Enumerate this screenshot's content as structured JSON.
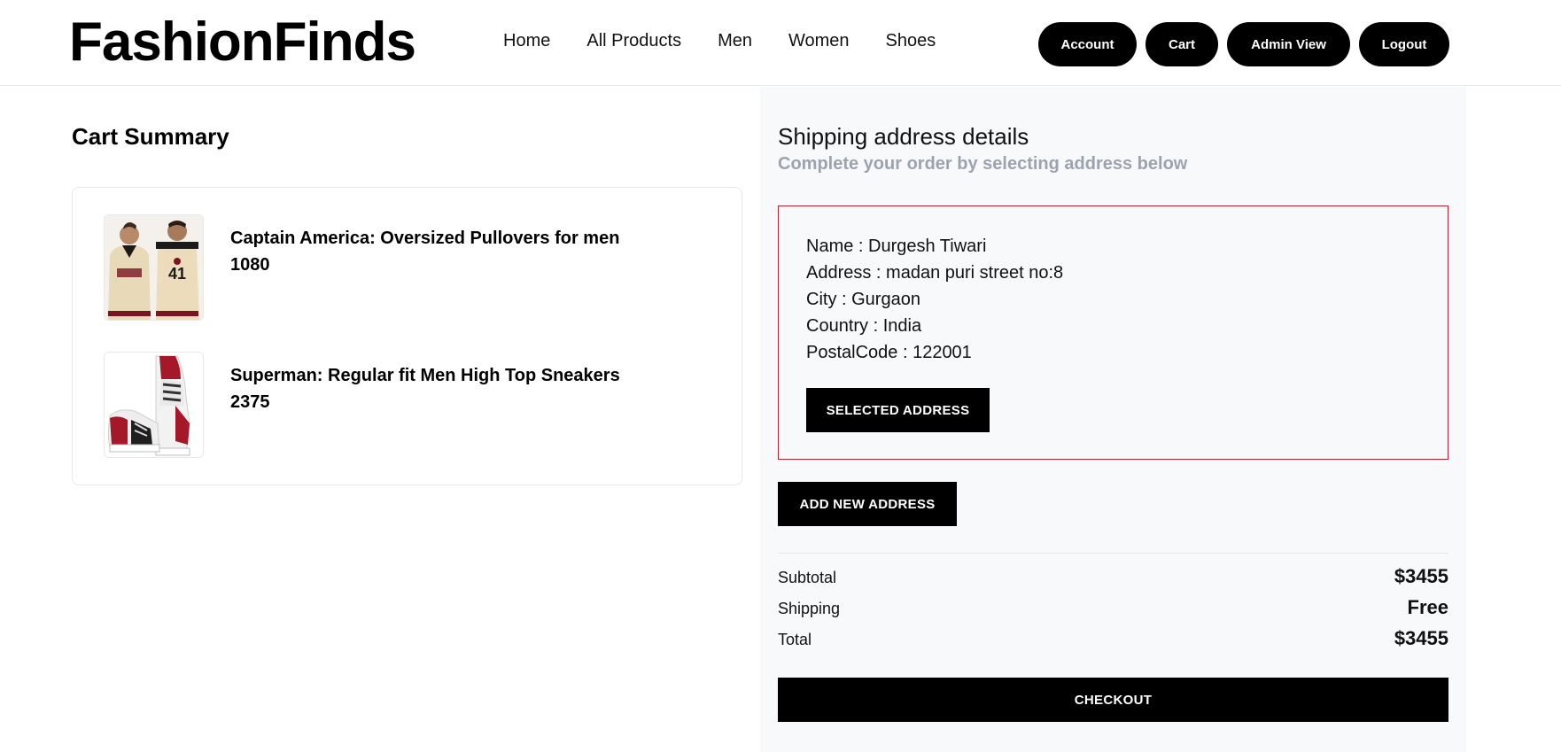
{
  "header": {
    "logo": "FashionFinds",
    "nav": [
      "Home",
      "All Products",
      "Men",
      "Women",
      "Shoes"
    ],
    "actions": [
      "Account",
      "Cart",
      "Admin View",
      "Logout"
    ]
  },
  "cart": {
    "title": "Cart Summary",
    "items": [
      {
        "name": "Captain America: Oversized Pullovers for men",
        "price": "1080",
        "image": "pullover-photo"
      },
      {
        "name": "Superman: Regular fit Men High Top Sneakers",
        "price": "2375",
        "image": "sneaker-photo"
      }
    ]
  },
  "shipping": {
    "title": "Shipping address details",
    "subtitle": "Complete your order by selecting address below",
    "address": {
      "name": "Name : Durgesh Tiwari",
      "street": "Address : madan puri street no:8",
      "city": "City : Gurgaon",
      "country": "Country : India",
      "postal": "PostalCode : 122001"
    },
    "selected_button": "SELECTED ADDRESS",
    "add_button": "ADD NEW ADDRESS"
  },
  "summary": {
    "subtotal_label": "Subtotal",
    "subtotal_value": "$3455",
    "shipping_label": "Shipping",
    "shipping_value": "Free",
    "total_label": "Total",
    "total_value": "$3455",
    "checkout": "CHECKOUT"
  },
  "colors": {
    "accent": "#000000",
    "selected_border": "#b4233a",
    "panel_bg": "#f8f9fb",
    "muted_text": "#9ca3af"
  }
}
